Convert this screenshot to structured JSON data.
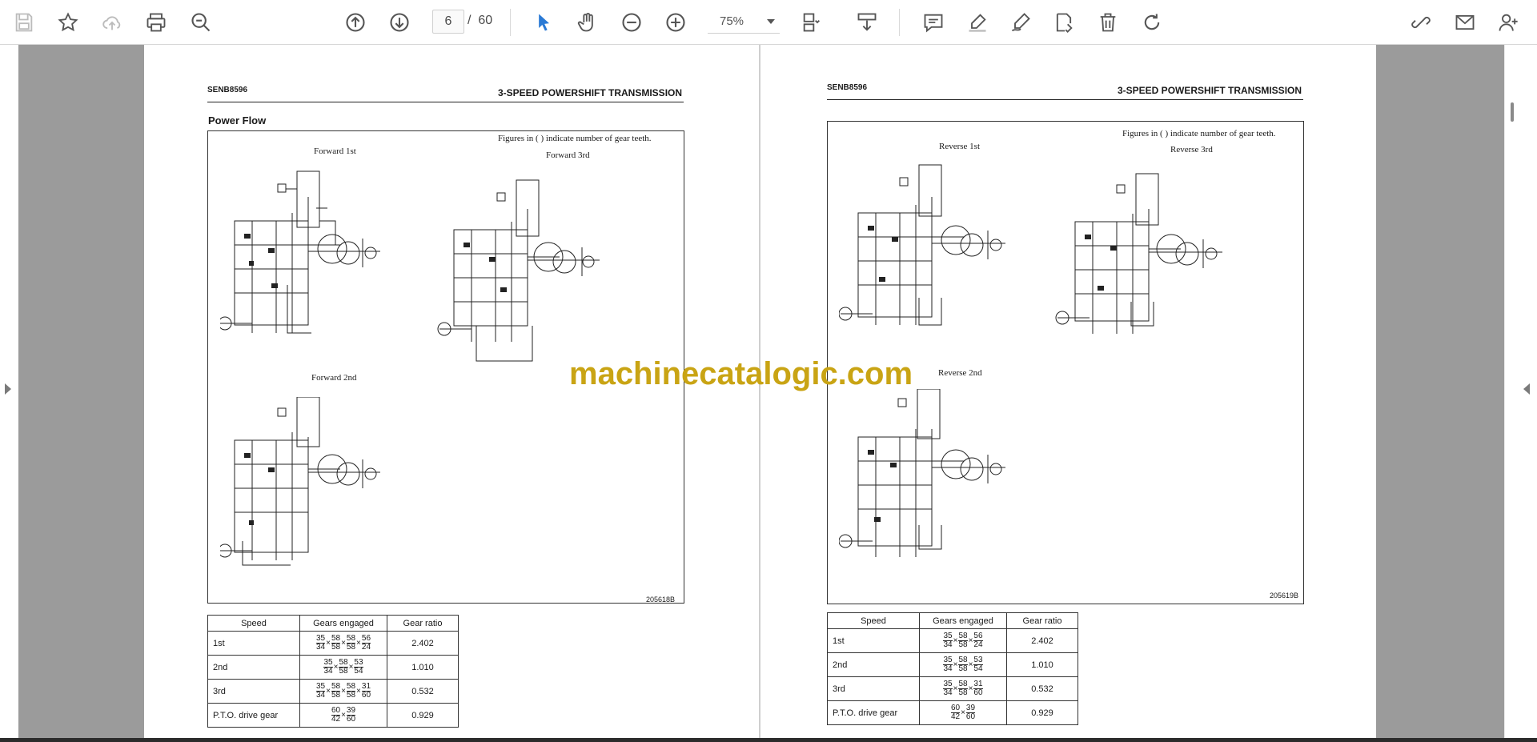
{
  "toolbar": {
    "page_current": "6",
    "page_separator": "/",
    "page_total": "60",
    "zoom": "75%",
    "icons": [
      "save-icon",
      "bookmark-star-icon",
      "cloud-upload-icon",
      "print-icon",
      "zoom-search-icon",
      "page-up-icon",
      "page-down-icon",
      "select-cursor-icon",
      "hand-pan-icon",
      "zoom-out-icon",
      "zoom-in-icon",
      "page-view-icon",
      "scroll-mode-icon",
      "comment-icon",
      "highlight-pen-icon",
      "draw-pen-icon",
      "fill-sign-icon",
      "delete-icon",
      "rotate-icon",
      "share-link-icon",
      "email-icon",
      "add-user-icon"
    ],
    "accent_color": "#2a7ad5"
  },
  "watermark": "machinecatalogic.com",
  "page_left": {
    "doc_number": "SENB8596",
    "doc_title": "3-SPEED POWERSHIFT TRANSMISSION",
    "section_title": "Power Flow",
    "figure_note": "Figures in (   ) indicate number of gear teeth.",
    "diagram_labels": [
      "Forward 1st",
      "Forward 3rd",
      "Forward 2nd"
    ],
    "figure_id": "205618B",
    "table": {
      "headers": [
        "Speed",
        "Gears engaged",
        "Gear ratio"
      ],
      "rows": [
        {
          "speed": "1st",
          "fractions": [
            [
              "35",
              "34"
            ],
            [
              "58",
              "58"
            ],
            [
              "58",
              "58"
            ],
            [
              "56",
              "24"
            ]
          ],
          "ratio": "2.402"
        },
        {
          "speed": "2nd",
          "fractions": [
            [
              "35",
              "34"
            ],
            [
              "58",
              "58"
            ],
            [
              "53",
              "54"
            ]
          ],
          "ratio": "1.010"
        },
        {
          "speed": "3rd",
          "fractions": [
            [
              "35",
              "34"
            ],
            [
              "58",
              "58"
            ],
            [
              "58",
              "58"
            ],
            [
              "31",
              "60"
            ]
          ],
          "ratio": "0.532"
        },
        {
          "speed": "P.T.O. drive gear",
          "fractions": [
            [
              "60",
              "42"
            ],
            [
              "39",
              "60"
            ]
          ],
          "ratio": "0.929"
        }
      ]
    }
  },
  "page_right": {
    "doc_number": "SENB8596",
    "doc_title": "3-SPEED POWERSHIFT TRANSMISSION",
    "figure_note": "Figures in (   ) indicate number of gear teeth.",
    "diagram_labels": [
      "Reverse 1st",
      "Reverse 3rd",
      "Reverse 2nd"
    ],
    "figure_id": "205619B",
    "table": {
      "headers": [
        "Speed",
        "Gears engaged",
        "Gear ratio"
      ],
      "rows": [
        {
          "speed": "1st",
          "fractions": [
            [
              "35",
              "34"
            ],
            [
              "58",
              "58"
            ],
            [
              "56",
              "24"
            ]
          ],
          "ratio": "2.402"
        },
        {
          "speed": "2nd",
          "fractions": [
            [
              "35",
              "34"
            ],
            [
              "58",
              "58"
            ],
            [
              "53",
              "54"
            ]
          ],
          "ratio": "1.010"
        },
        {
          "speed": "3rd",
          "fractions": [
            [
              "35",
              "34"
            ],
            [
              "58",
              "58"
            ],
            [
              "31",
              "60"
            ]
          ],
          "ratio": "0.532"
        },
        {
          "speed": "P.T.O. drive gear",
          "fractions": [
            [
              "60",
              "42"
            ],
            [
              "39",
              "60"
            ]
          ],
          "ratio": "0.929"
        }
      ]
    }
  }
}
